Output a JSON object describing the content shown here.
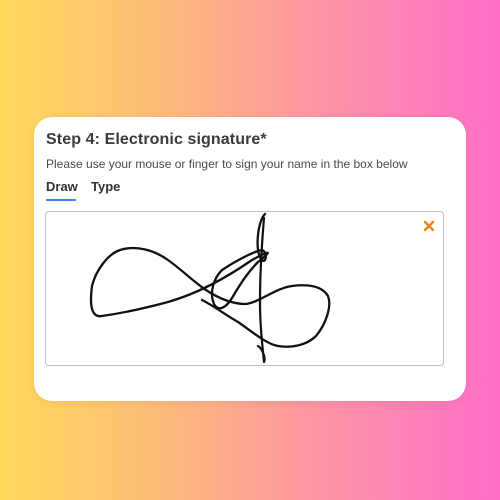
{
  "form": {
    "title": "Step 4: Electronic signature*",
    "instructions": "Please use your mouse or finger to sign your name in the box below",
    "tabs": [
      {
        "label": "Draw",
        "active": true
      },
      {
        "label": "Type",
        "active": false
      }
    ]
  },
  "signature_pad": {
    "clear_icon": "close-icon",
    "clear_color": "#e8870f",
    "border_color": "#b9c2d6"
  },
  "colors": {
    "active_tab_underline": "#3b82f6",
    "ink": "#111111"
  }
}
